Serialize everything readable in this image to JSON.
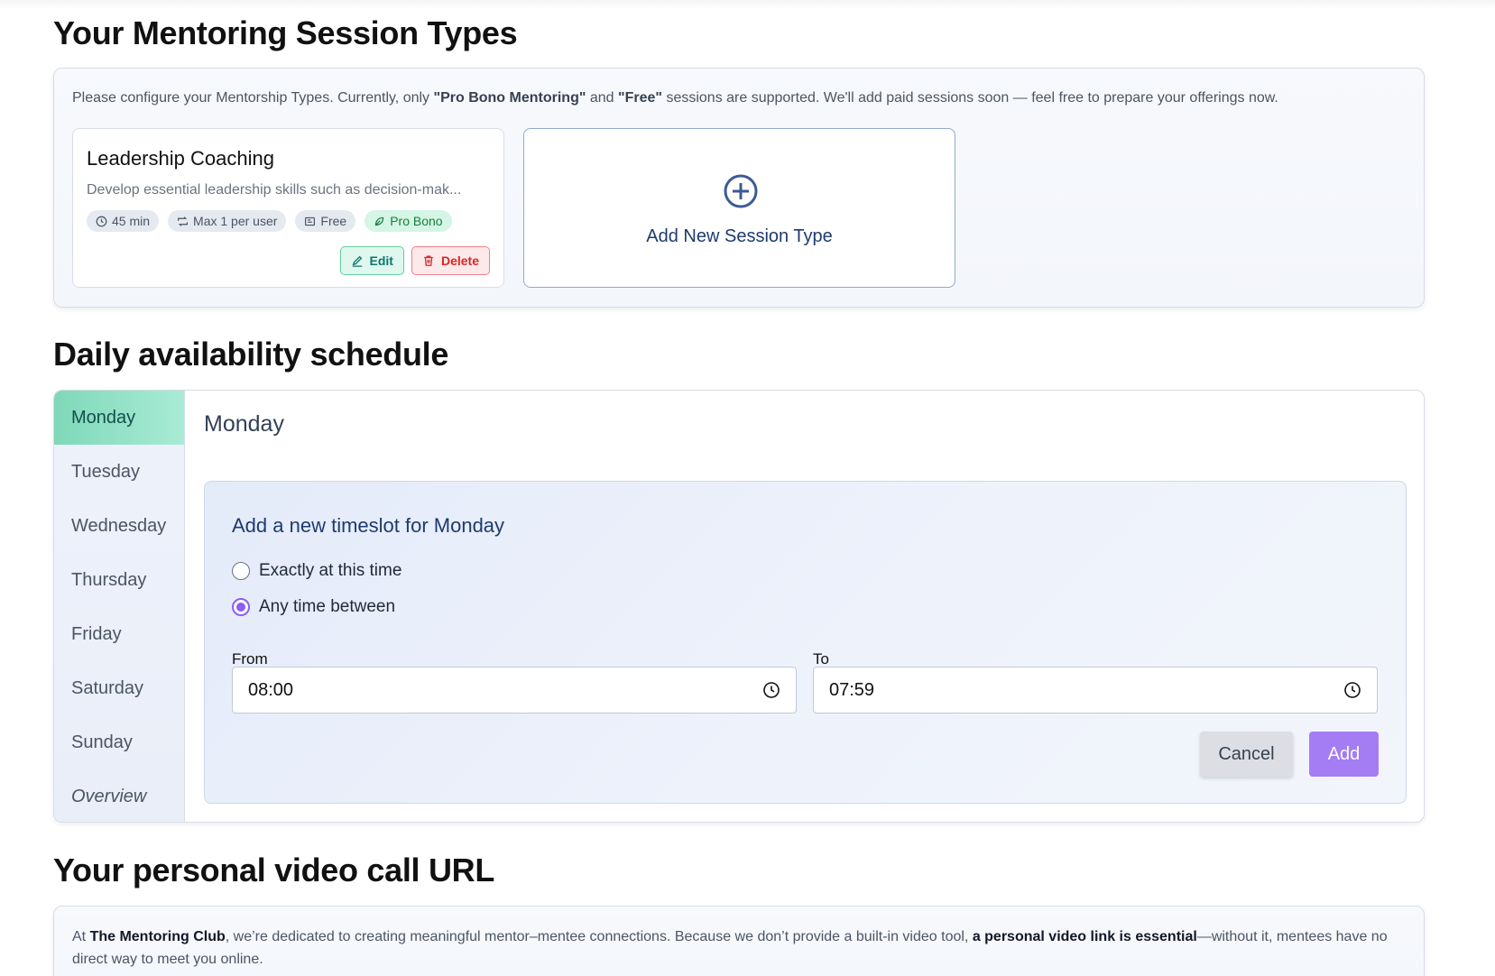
{
  "session_section": {
    "title": "Your Mentoring Session Types",
    "intro_prefix": "Please configure your Mentorship Types. Currently, only ",
    "intro_bold1": "\"Pro Bono Mentoring\"",
    "intro_and": " and ",
    "intro_bold2": "\"Free\"",
    "intro_suffix": " sessions are supported. We'll add paid sessions soon — feel free to prepare your offerings now.",
    "session": {
      "title": "Leadership Coaching",
      "description": "Develop essential leadership skills such as decision-mak...",
      "duration": "45 min",
      "limit": "Max 1 per user",
      "price": "Free",
      "type": "Pro Bono",
      "edit_label": "Edit",
      "delete_label": "Delete"
    },
    "add_new_label": "Add New Session Type"
  },
  "schedule_section": {
    "title": "Daily availability schedule",
    "days": [
      "Monday",
      "Tuesday",
      "Wednesday",
      "Thursday",
      "Friday",
      "Saturday",
      "Sunday",
      "Overview"
    ],
    "selected_day": "Monday",
    "slot_form": {
      "title": "Add a new timeslot for Monday",
      "option_exact": "Exactly at this time",
      "option_between": "Any time between",
      "selected_option": "between",
      "from_label": "From",
      "from_value": "08:00",
      "to_label": "To",
      "to_value": "07:59",
      "cancel_label": "Cancel",
      "add_label": "Add"
    },
    "accent_color": "#8b5cf6"
  },
  "video_section": {
    "title": "Your personal video call URL",
    "text_prefix": "At ",
    "text_bold1": "The Mentoring Club",
    "text_mid": ", we’re dedicated to creating meaningful mentor–mentee connections. Because we don’t provide a built-in video tool, ",
    "text_bold2": "a personal video link is essential",
    "text_suffix": "—without it, mentees have no direct way to meet you online."
  }
}
